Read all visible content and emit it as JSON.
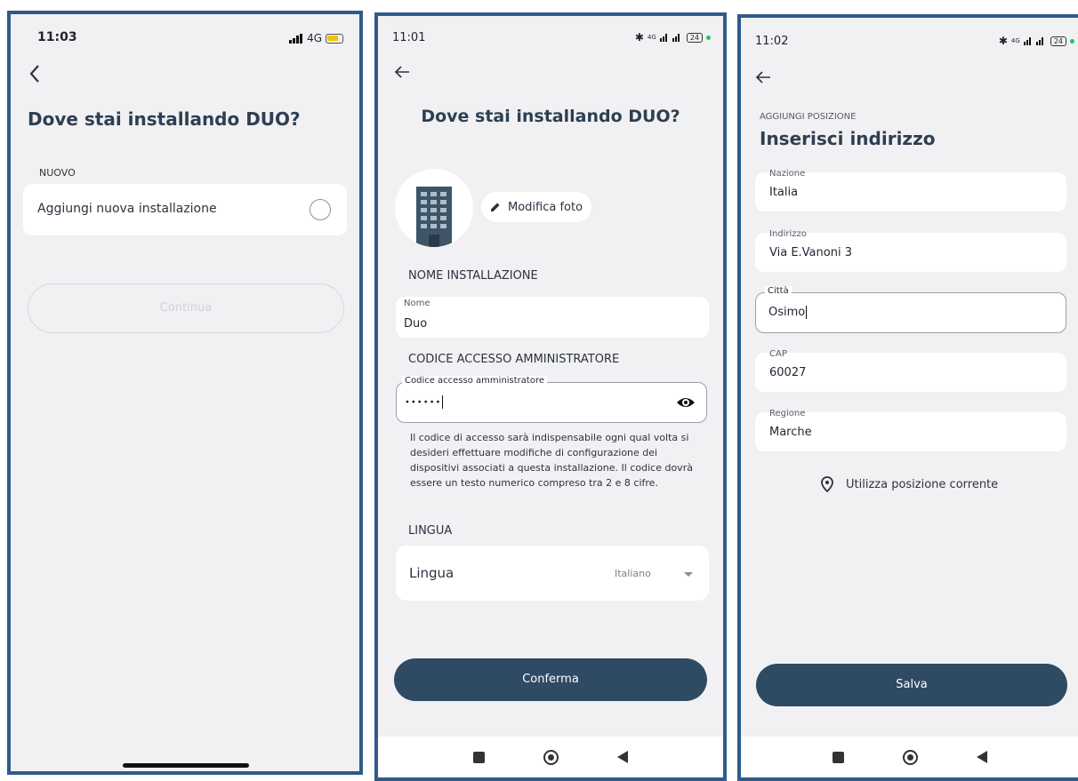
{
  "screen1": {
    "time": "11:03",
    "network": "4G",
    "title": "Dove stai installando DUO?",
    "section": "NUOVO",
    "option_label": "Aggiungi nuova installazione",
    "continue_label": "Continua"
  },
  "screen2": {
    "time": "11:01",
    "network_badge": "4G",
    "battery": "24",
    "title": "Dove stai installando DUO?",
    "edit_photo_label": "Modifica foto",
    "name_section": "NOME INSTALLAZIONE",
    "name_field_label": "Nome",
    "name_field_value": "Duo",
    "code_section": "CODICE ACCESSO AMMINISTRATORE",
    "code_field_label": "Codice accesso amministratore",
    "code_field_value": "••••••",
    "help_text": "Il codice di accesso sarà indispensabile ogni qual volta si desideri effettuare modifiche di configurazione dei dispositivi associati a questa installazione. Il codice dovrà essere un testo numerico compreso tra 2 e 8 cifre.",
    "language_section": "LINGUA",
    "language_label": "Lingua",
    "language_value": "Italiano",
    "confirm_label": "Conferma"
  },
  "screen3": {
    "time": "11:02",
    "network_badge": "4G",
    "battery": "24",
    "subtitle": "AGGIUNGI POSIZIONE",
    "title": "Inserisci indirizzo",
    "fields": [
      {
        "label": "Nazione",
        "value": "Italia"
      },
      {
        "label": "Indirizzo",
        "value": "Via E.Vanoni 3"
      },
      {
        "label": "Città",
        "value": "Osimo"
      },
      {
        "label": "CAP",
        "value": "60027"
      },
      {
        "label": "Regione",
        "value": "Marche"
      }
    ],
    "use_location_label": "Utilizza posizione corrente",
    "save_label": "Salva"
  }
}
